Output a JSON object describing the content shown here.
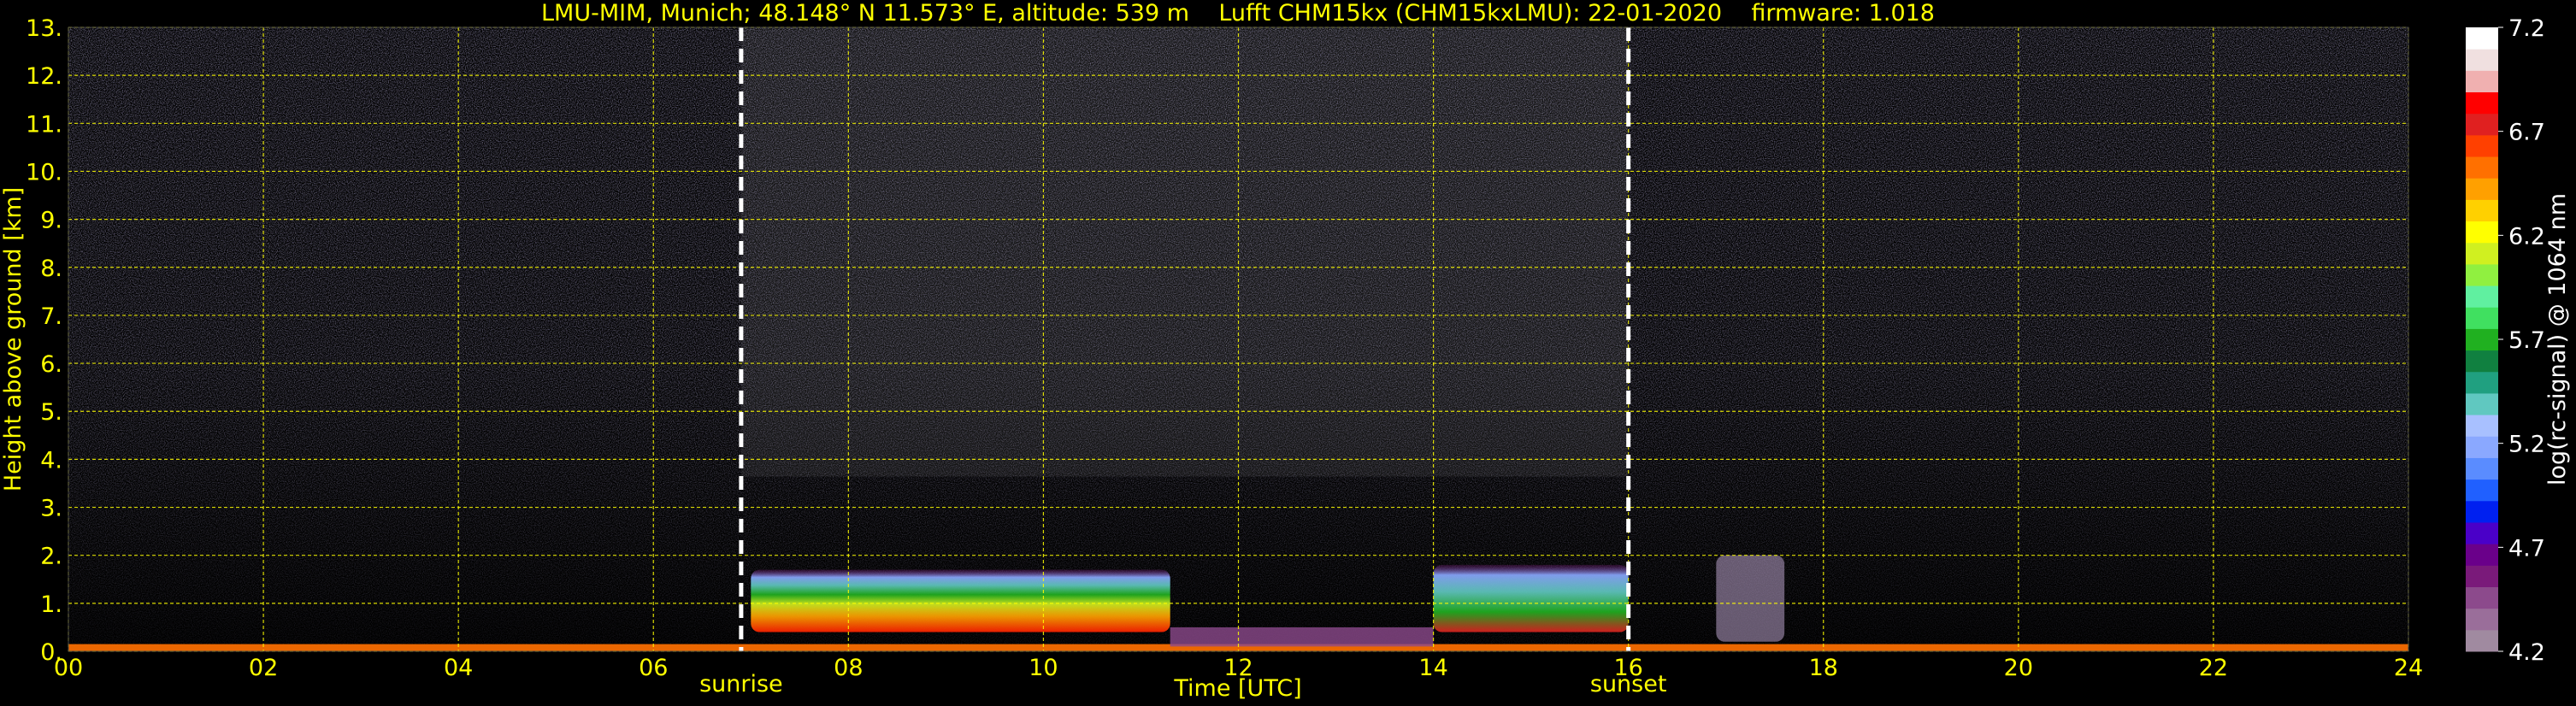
{
  "chart_data": {
    "type": "heatmap",
    "title": "LMU-MIM, Munich; 48.148° N 11.573° E, altitude: 539 m    Lufft CHM15kx (CHM15kxLMU): 22-01-2020    firmware: 1.018",
    "xlabel": "Time [UTC]",
    "ylabel": "Height above ground [km]",
    "xlim": [
      0,
      24
    ],
    "ylim": [
      0,
      13
    ],
    "x_ticks": [
      "00",
      "02",
      "04",
      "06",
      "08",
      "10",
      "12",
      "14",
      "16",
      "18",
      "20",
      "22",
      "24"
    ],
    "x_tick_values": [
      0,
      2,
      4,
      6,
      8,
      10,
      12,
      14,
      16,
      18,
      20,
      22,
      24
    ],
    "y_ticks": [
      "0.",
      "1.",
      "2.",
      "3.",
      "4.",
      "5.",
      "6.",
      "7.",
      "8.",
      "9.",
      "10.",
      "11.",
      "12.",
      "13."
    ],
    "y_tick_values": [
      0,
      1,
      2,
      3,
      4,
      5,
      6,
      7,
      8,
      9,
      10,
      11,
      12,
      13
    ],
    "grid": true,
    "grid_color": "#ffff00",
    "text_color": "#ffff00",
    "background": "#000000",
    "annotations": [
      {
        "label": "sunrise",
        "x": 6.9
      },
      {
        "label": "sunset",
        "x": 16.0
      }
    ],
    "colorbar": {
      "label": "log(rc-signal) @ 1064 nm",
      "range": [
        4.2,
        7.2
      ],
      "tick_labels": [
        "4.2",
        "4.7",
        "5.2",
        "5.7",
        "6.2",
        "6.7",
        "7.2"
      ],
      "tick_values": [
        4.2,
        4.7,
        5.2,
        5.7,
        6.2,
        6.7,
        7.2
      ],
      "colors": [
        "#a08aa0",
        "#9a6e9a",
        "#8c4a8c",
        "#7a1a7a",
        "#6a008a",
        "#4a00c8",
        "#0020f0",
        "#2060ff",
        "#5a8cff",
        "#8aa8ff",
        "#a8c0ff",
        "#60c8c0",
        "#20a080",
        "#108040",
        "#20b020",
        "#40e060",
        "#60f0a0",
        "#90f040",
        "#d0f020",
        "#ffff00",
        "#ffd000",
        "#ffa000",
        "#ff7000",
        "#ff4000",
        "#e02020",
        "#ff0000",
        "#f0b0b0",
        "#f0e0e0",
        "#ffffff"
      ]
    },
    "layers": [
      {
        "name": "aerosol layer",
        "x_start": 7.0,
        "x_end": 11.3,
        "height_km": [
          0.4,
          1.7
        ],
        "peak_log_signal": 6.3
      },
      {
        "name": "aerosol layer",
        "x_start": 14.0,
        "x_end": 16.0,
        "height_km": [
          0.4,
          1.8
        ],
        "peak_log_signal": 6.0
      },
      {
        "name": "surface layer",
        "x_start": 0,
        "x_end": 24,
        "height_km": [
          0,
          0.15
        ],
        "peak_log_signal": 6.5
      },
      {
        "name": "weak signal",
        "x_start": 16.9,
        "x_end": 17.6,
        "height_km": [
          0.2,
          2.0
        ],
        "peak_log_signal": 4.6
      }
    ]
  }
}
